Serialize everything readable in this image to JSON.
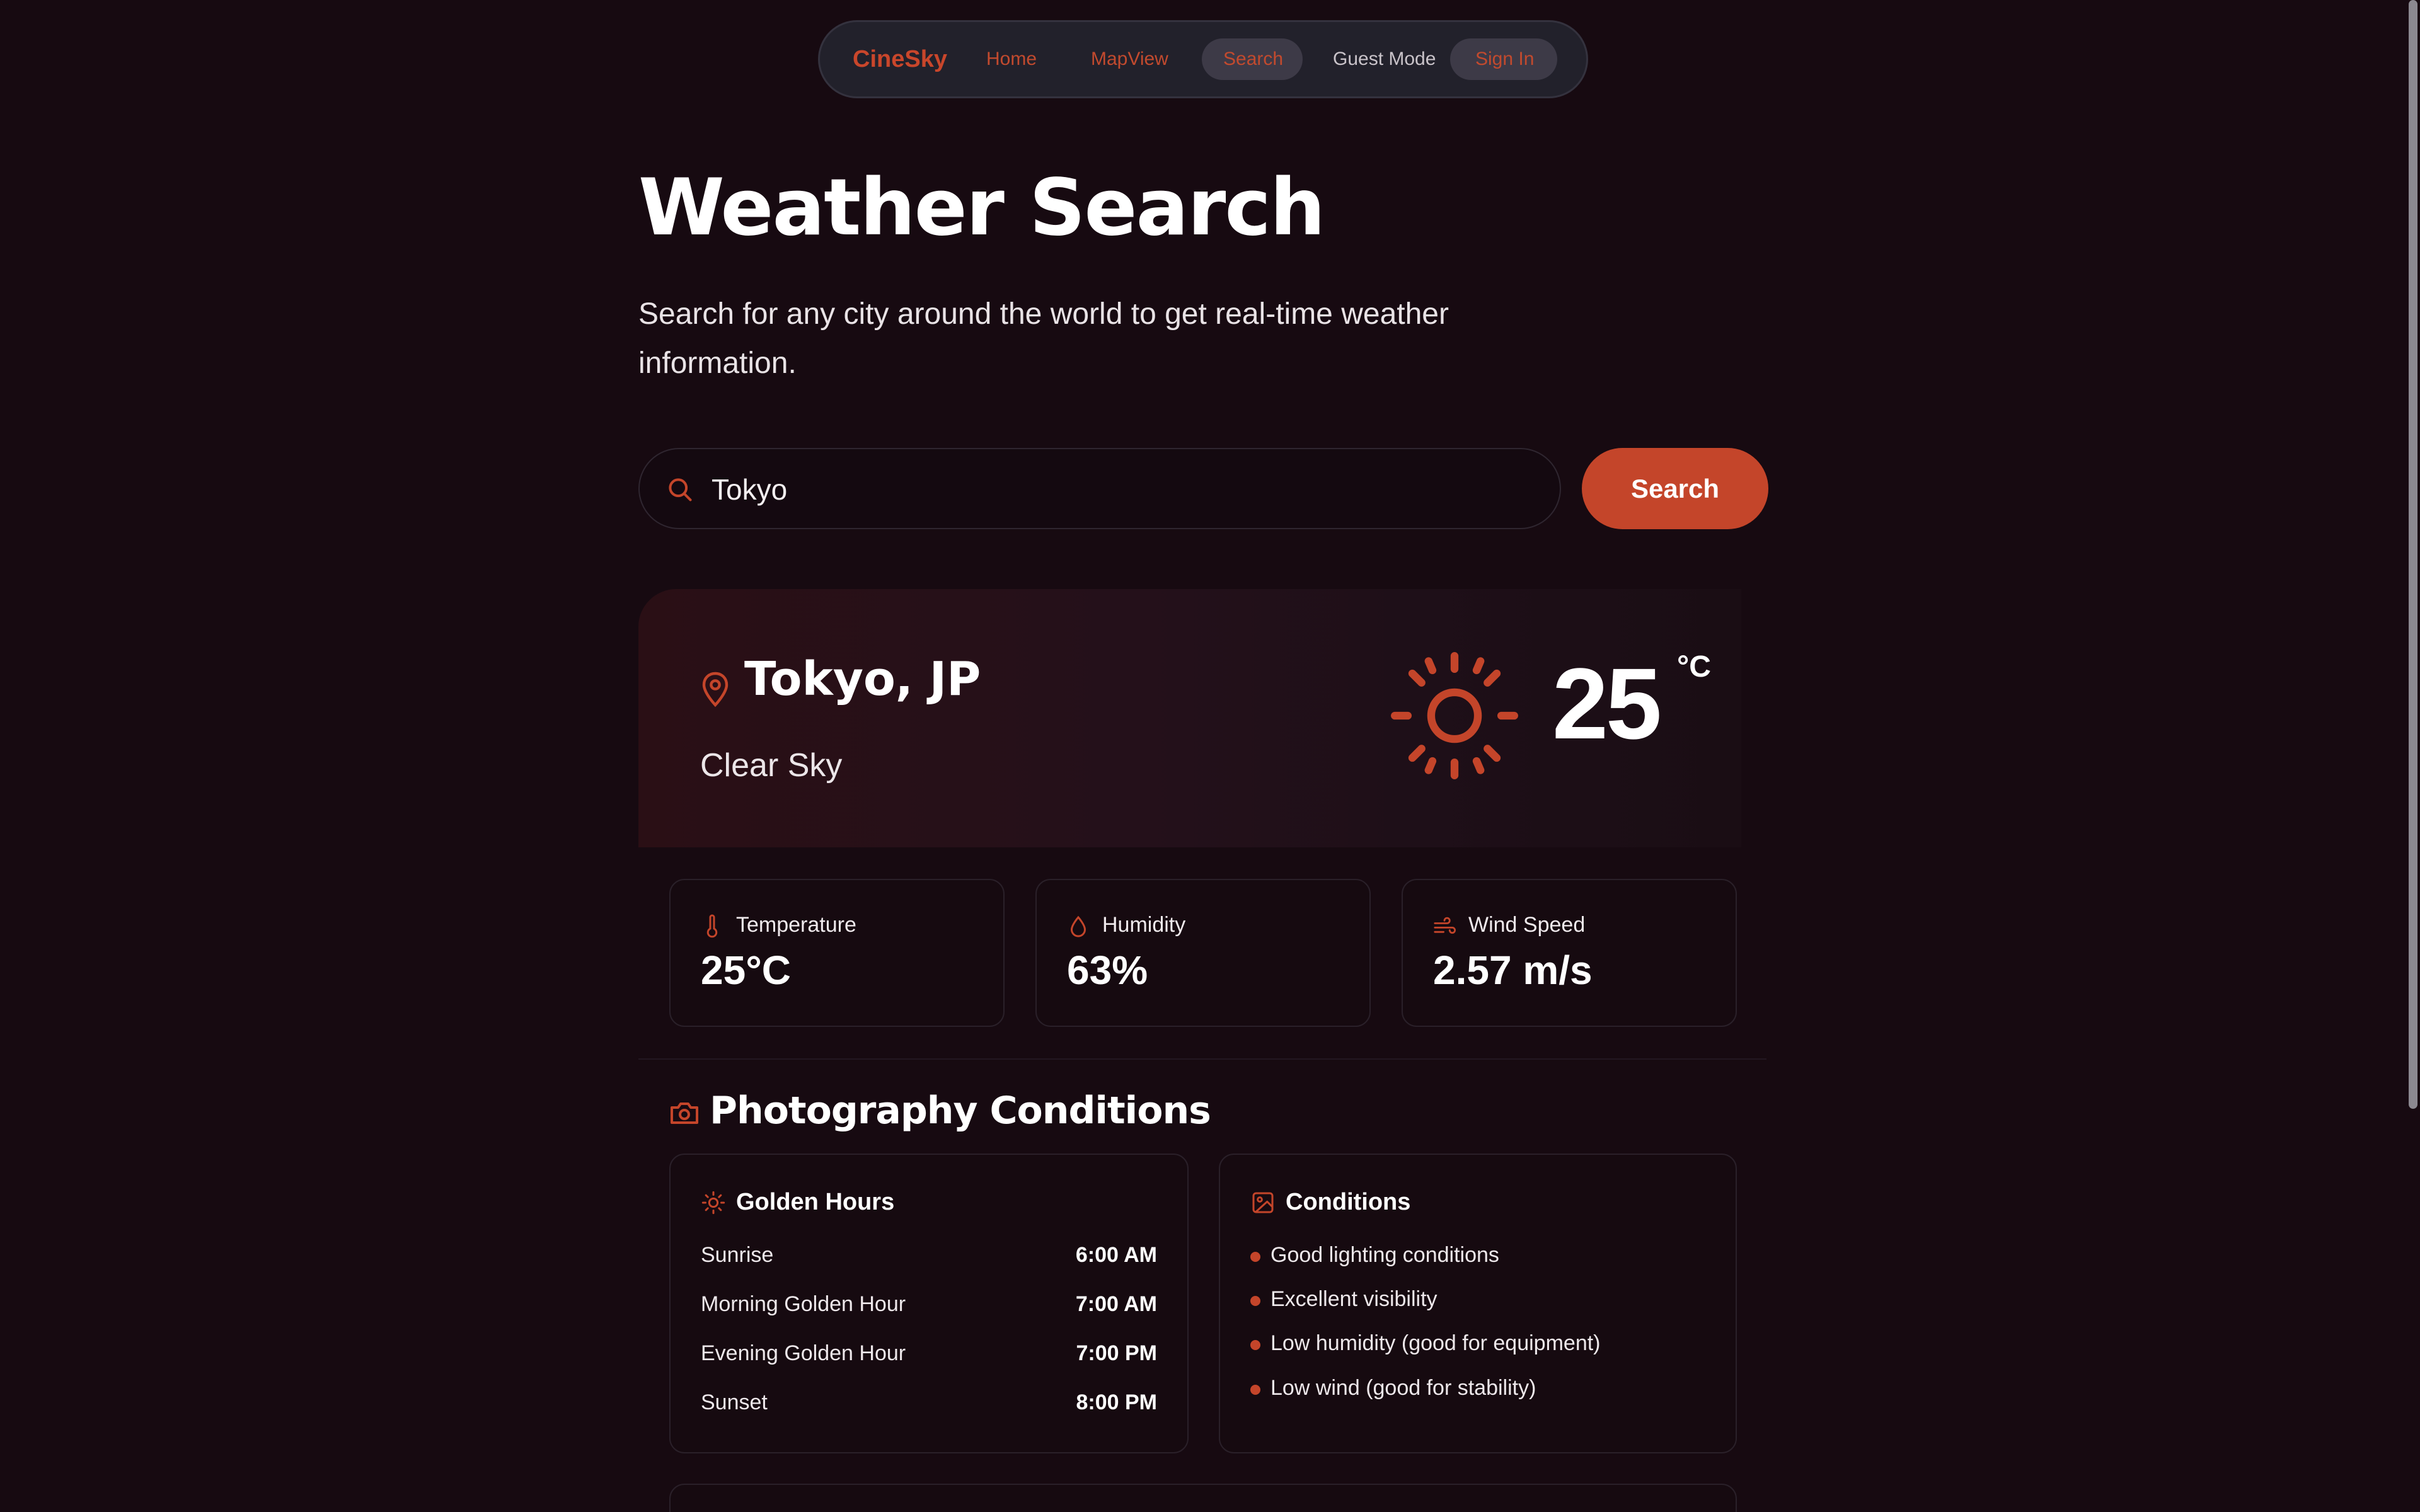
{
  "nav": {
    "brand": "CineSky",
    "links": [
      "Home",
      "MapView",
      "Search"
    ],
    "guest": "Guest Mode",
    "signin": "Sign In"
  },
  "header": {
    "title": "Weather Search",
    "subtitle": "Search for any city around the world to get real-time weather information."
  },
  "search": {
    "value": "Tokyo",
    "button_label": "Search"
  },
  "current": {
    "city": "Tokyo, JP",
    "condition": "Clear Sky",
    "temp": "25",
    "unit": "°C",
    "icon": "sun-icon"
  },
  "stats": [
    {
      "label": "Temperature",
      "value": "25°C",
      "icon": "thermometer-icon"
    },
    {
      "label": "Humidity",
      "value": "63%",
      "icon": "droplet-icon"
    },
    {
      "label": "Wind Speed",
      "value": "2.57 m/s",
      "icon": "wind-icon"
    }
  ],
  "photography": {
    "title": "Photography Conditions",
    "golden": {
      "title": "Golden Hours",
      "rows": [
        {
          "label": "Sunrise",
          "time": "6:00 AM"
        },
        {
          "label": "Morning Golden Hour",
          "time": "7:00 AM"
        },
        {
          "label": "Evening Golden Hour",
          "time": "7:00 PM"
        },
        {
          "label": "Sunset",
          "time": "8:00 PM"
        }
      ]
    },
    "conditions": {
      "title": "Conditions",
      "items": [
        "Good lighting conditions",
        "Excellent visibility",
        "Low humidity (good for equipment)",
        "Low wind (good for stability)"
      ]
    }
  },
  "colors": {
    "accent": "#c4452a",
    "background": "#170a11",
    "nav_bg": "#22212b"
  }
}
